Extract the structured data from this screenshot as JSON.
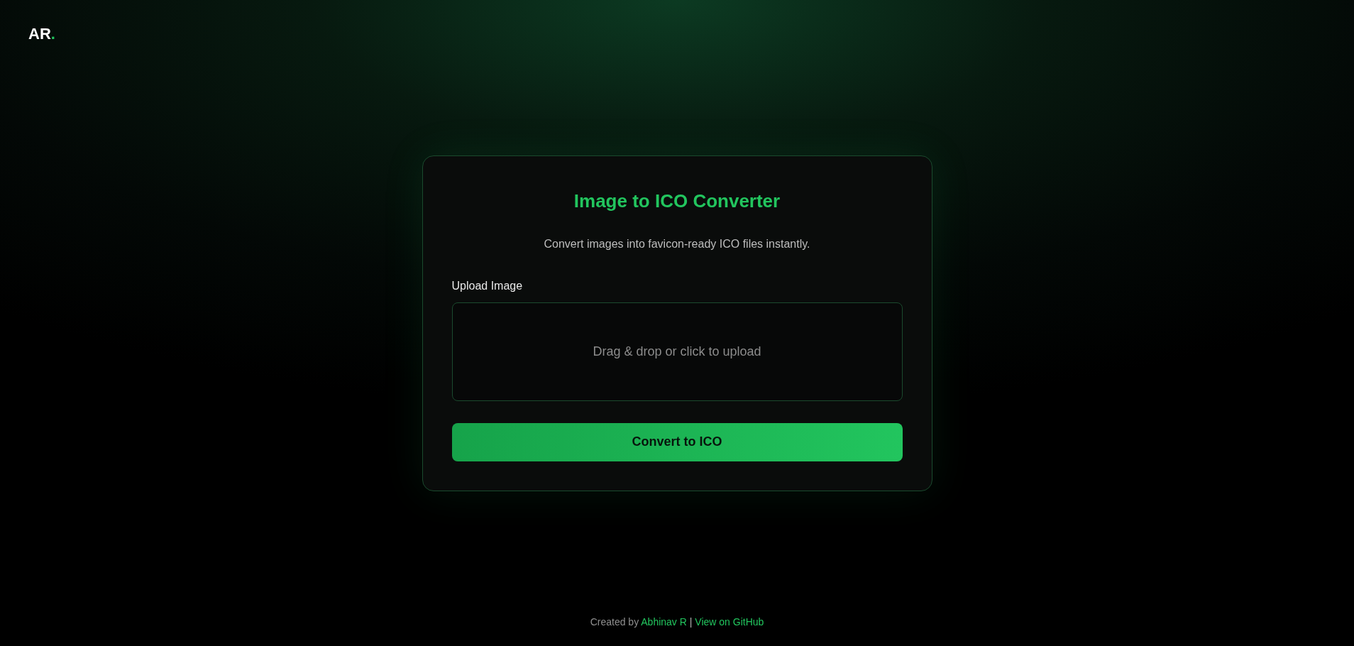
{
  "logo": {
    "text": "AR",
    "accent": "."
  },
  "card": {
    "title": "Image to ICO Converter",
    "subtitle": "Convert images into favicon-ready ICO files instantly.",
    "upload": {
      "label": "Upload Image",
      "prompt": "Drag & drop or click to upload"
    },
    "button": {
      "label": "Convert to ICO"
    }
  },
  "footer": {
    "prefix": "Created by",
    "author": {
      "label": "Abhinav R"
    },
    "separator": "|",
    "github": {
      "label": "View on GitHub"
    }
  }
}
